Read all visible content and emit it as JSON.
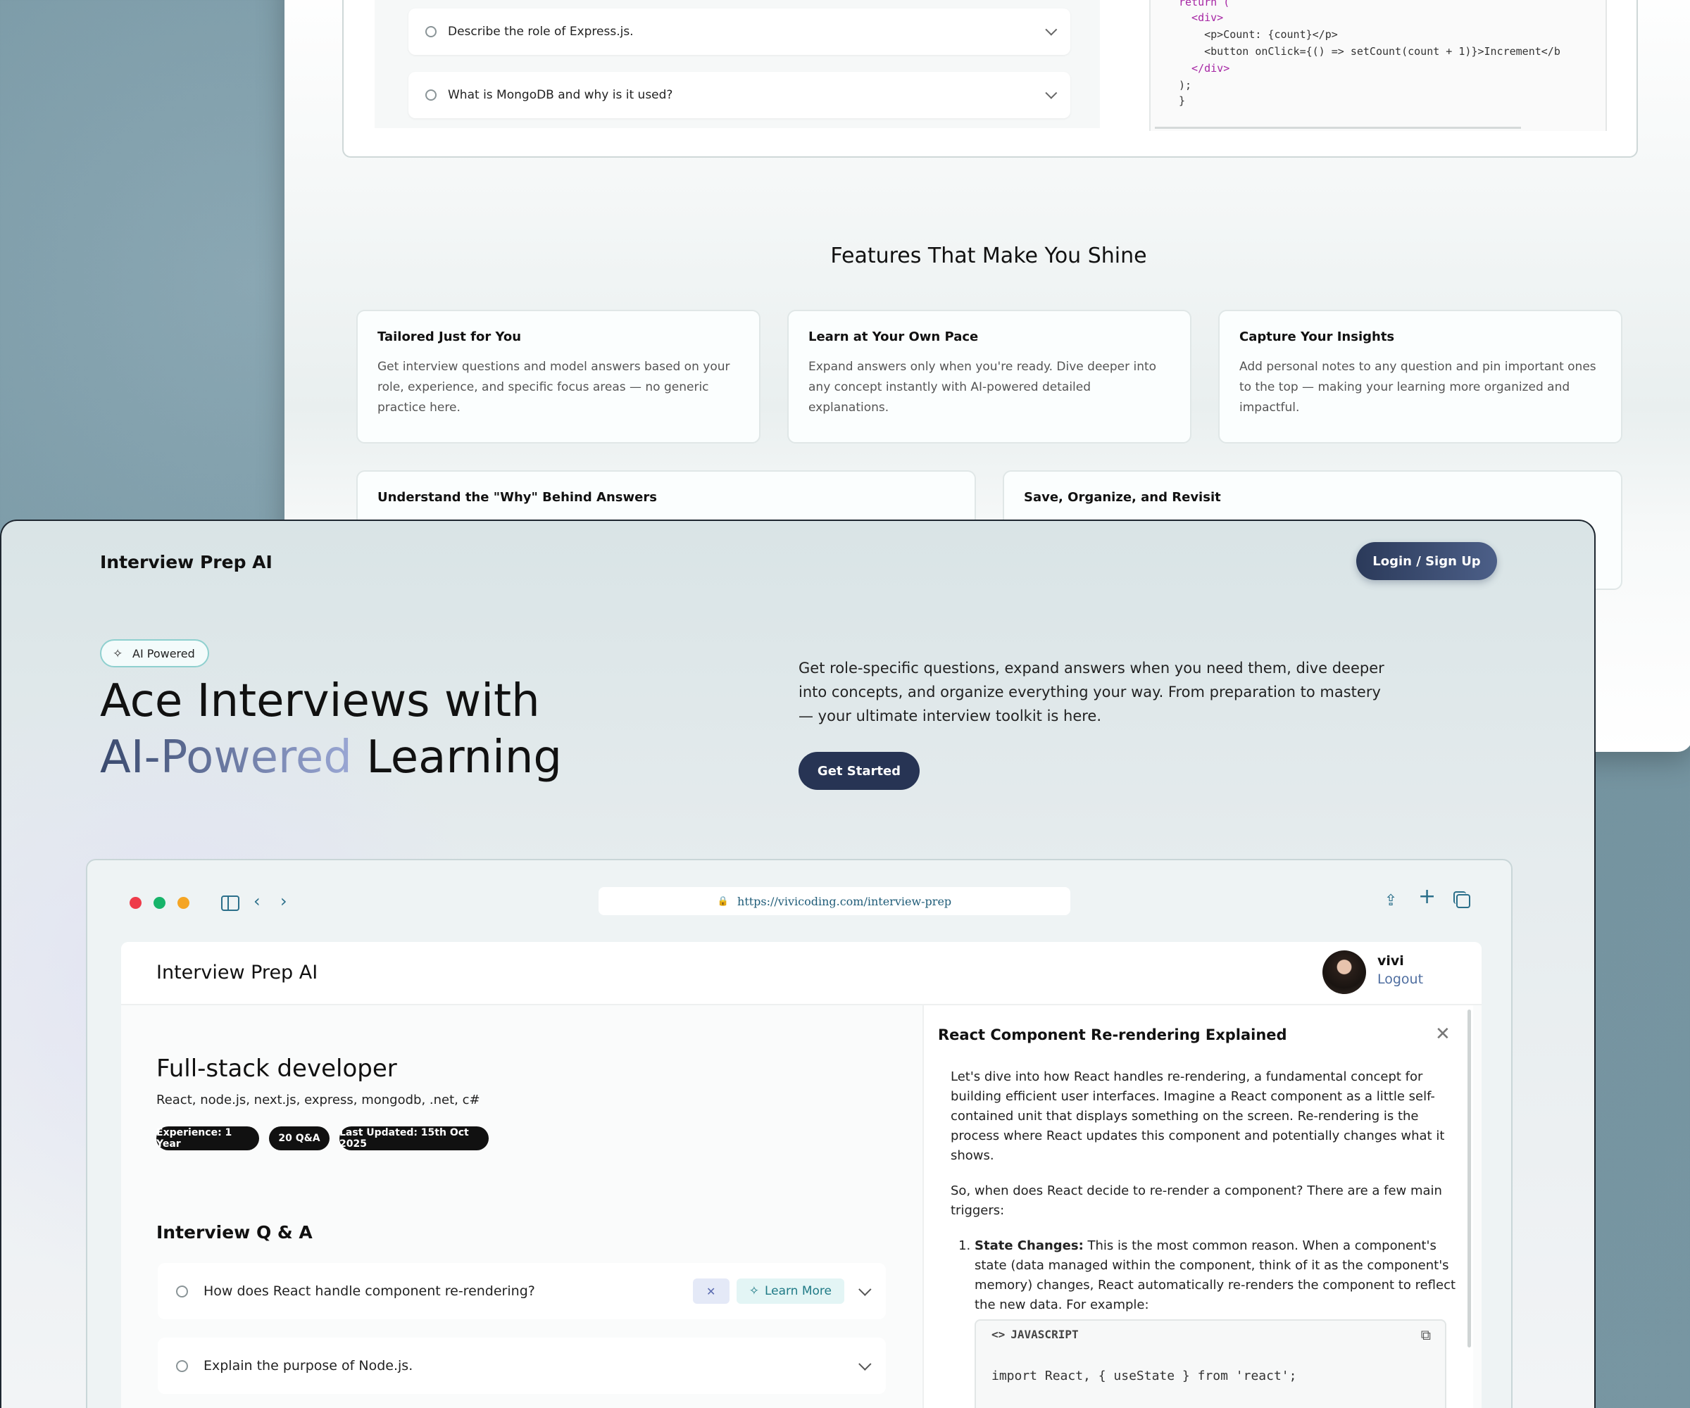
{
  "back": {
    "faq": [
      {
        "question": "Describe the role of Express.js."
      },
      {
        "question": "What is MongoDB and why is it used?"
      }
    ],
    "code_lines": [
      "return (",
      "  <div>",
      "    <p>Count: {count}</p>",
      "    <button onClick={() => setCount(count + 1)}>Increment</b",
      "  </div>",
      ");",
      "}"
    ],
    "features_title": "Features That Make You Shine",
    "features": [
      {
        "title": "Tailored Just for You",
        "text": "Get interview questions and model answers based on your role, experience, and specific focus areas — no generic practice here."
      },
      {
        "title": "Learn at Your Own Pace",
        "text": "Expand answers only when you're ready. Dive deeper into any concept instantly with AI-powered detailed explanations."
      },
      {
        "title": "Capture Your Insights",
        "text": "Add personal notes to any question and pin important ones to the top — making your learning more organized and impactful."
      },
      {
        "title": "Understand the \"Why\" Behind Answers",
        "text": ""
      },
      {
        "title": "Save, Organize, and Revisit",
        "text": ""
      }
    ]
  },
  "front": {
    "brand": "Interview Prep AI",
    "login_label": "Login / Sign Up",
    "badge": "AI Powered",
    "hero": {
      "line1": "Ace Interviews with",
      "highlight": "AI-Powered",
      "line2_rest": " Learning",
      "description": "Get role-specific questions, expand answers when you need them, dive deeper into concepts, and organize everything your way. From preparation to mastery — your ultimate interview toolkit is here.",
      "cta": "Get Started"
    },
    "browser": {
      "url": "https://vivicoding.com/interview-prep",
      "app": {
        "brand": "Interview Prep AI",
        "user": {
          "name": "vivi",
          "logout": "Logout"
        },
        "role": "Full-stack developer",
        "topics": "React, node.js, next.js, express, mongodb, .net, c#",
        "pills": [
          "Experience: 1 Year",
          "20 Q&A",
          "Last Updated: 15th Oct 2025"
        ],
        "qa_title": "Interview Q & A",
        "questions": [
          {
            "question": "How does React handle component re-rendering?",
            "learn_more": "Learn More"
          },
          {
            "question": "Explain the purpose of Node.js."
          }
        ],
        "explain": {
          "title": "React Component Re-rendering Explained",
          "para1": "Let's dive into how React handles re-rendering, a fundamental concept for building efficient user interfaces. Imagine a React component as a little self-contained unit that displays something on the screen. Re-rendering is the process where React updates this component and potentially changes what it shows.",
          "para2": "So, when does React decide to re-render a component? There are a few main triggers:",
          "item1_bold": "State Changes:",
          "item1_text": " This is the most common reason. When a component's state (data managed within the component, think of it as the component's memory) changes, React automatically re-renders the component to reflect the new data. For example:",
          "code_lang": "JAVASCRIPT",
          "code_line": "import React, { useState } from 'react';"
        }
      }
    }
  },
  "colors": {
    "accent": "#273454",
    "teal": "#1f7a86",
    "window_dot_red": "#ee3b4a",
    "window_dot_green": "#17b46a",
    "window_dot_yellow": "#f5a524"
  }
}
